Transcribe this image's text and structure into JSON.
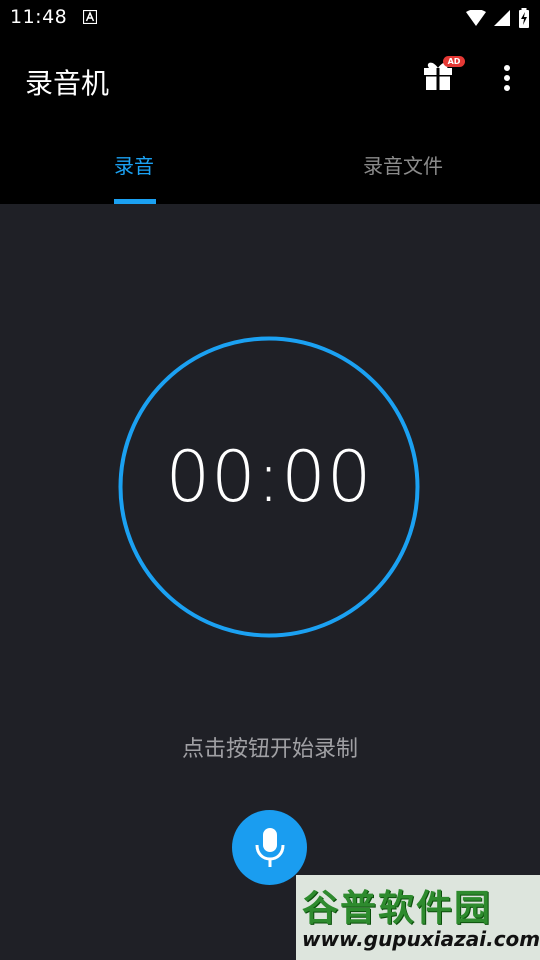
{
  "status_bar": {
    "time": "11:48",
    "icons": [
      "a-notification-icon",
      "wifi-icon",
      "cell-signal-icon",
      "battery-charging-icon"
    ]
  },
  "app_bar": {
    "title": "录音机",
    "gift_icon": "gift-icon",
    "ad_badge": "AD",
    "more_icon": "more-vert-icon"
  },
  "tabs": [
    {
      "label": "录音",
      "selected": true
    },
    {
      "label": "录音文件",
      "selected": false
    }
  ],
  "timer": {
    "value": "00:00"
  },
  "hint": "点击按钮开始录制",
  "record_button": {
    "icon": "microphone-icon"
  },
  "watermark": {
    "brand": "谷普软件园",
    "url": "www.gupuxiazai.com"
  },
  "colors": {
    "accent": "#1ba1f2",
    "background": "#1f2026",
    "bar": "#000000",
    "inactive_tab": "#8b8b8b",
    "hint_text": "#a0a0a4",
    "badge": "#e53935"
  }
}
